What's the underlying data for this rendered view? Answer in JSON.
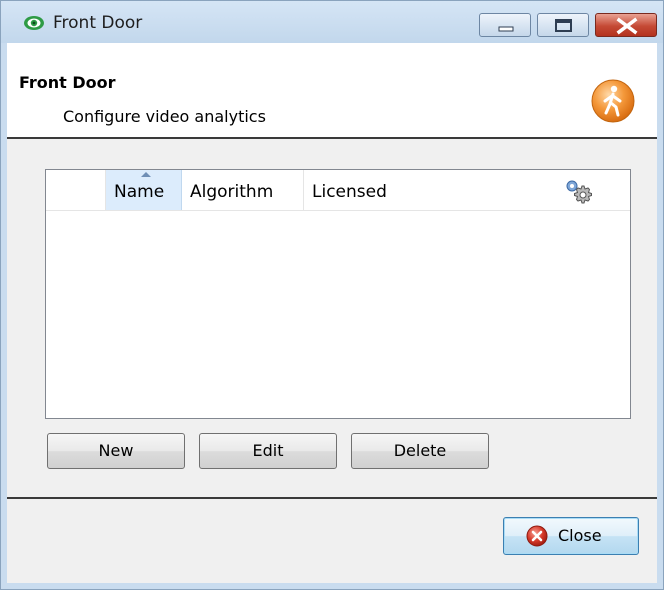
{
  "window": {
    "title": "Front Door"
  },
  "header": {
    "title": "Front Door",
    "subtitle": "Configure video analytics"
  },
  "list": {
    "columns": [
      "",
      "Name",
      "Algorithm",
      "Licensed"
    ],
    "sorted_column": "Name",
    "sort_direction": "ascending",
    "rows": []
  },
  "buttons": {
    "new_label": "New",
    "edit_label": "Edit",
    "delete_label": "Delete",
    "close_label": "Close"
  },
  "icons": {
    "app": "eye-icon",
    "header": "walking-person-icon",
    "columns": "gear-icon",
    "close": "close-circle-icon"
  },
  "colors": {
    "titlebar": "#c9dcef",
    "close_window_button": "#c54a35",
    "header_icon": "#f4983a",
    "app_icon": "#2e9b45",
    "close_icon": "#d63a2a"
  }
}
